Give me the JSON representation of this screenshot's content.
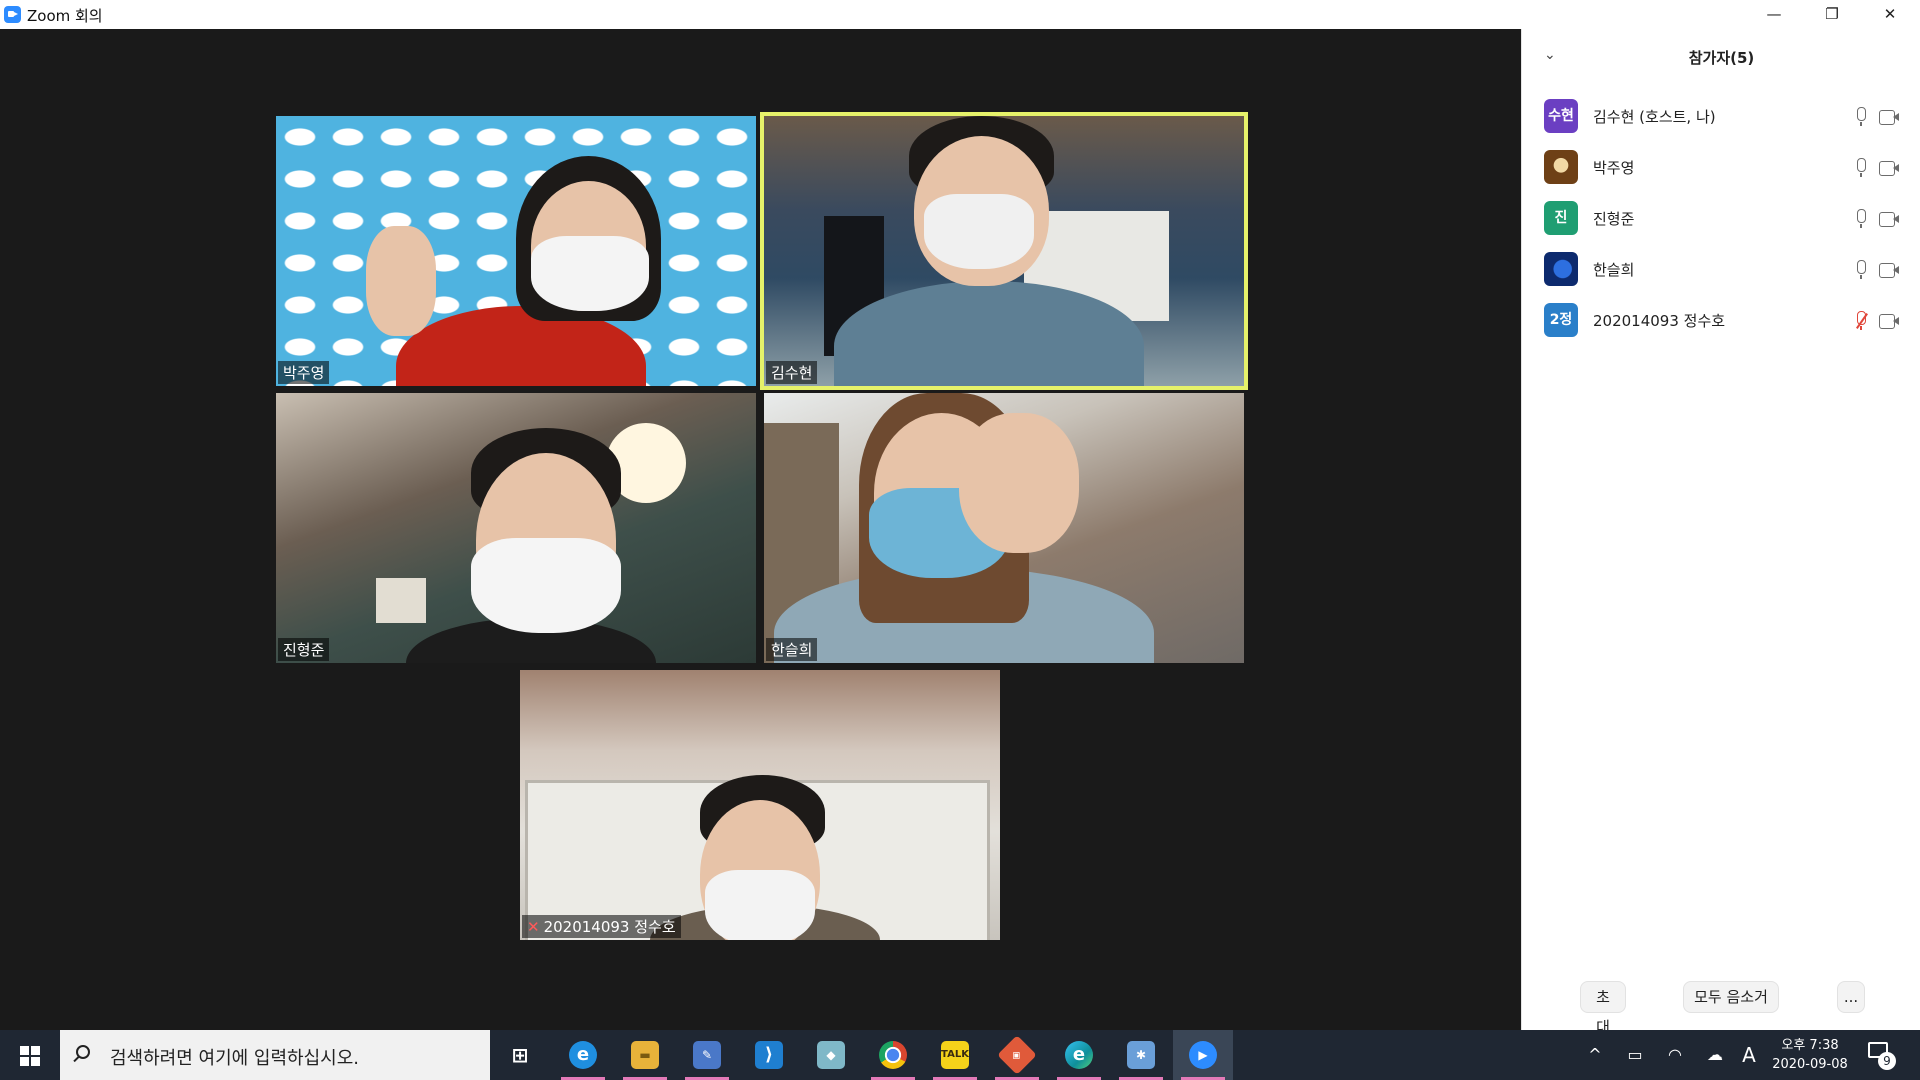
{
  "window": {
    "title": "Zoom 회의",
    "minimize_glyph": "—",
    "restore_glyph": "❐",
    "close_glyph": "✕"
  },
  "stage": {
    "tiles": [
      {
        "name": "박주영",
        "active": false,
        "muted": false
      },
      {
        "name": "김수현",
        "active": true,
        "muted": false
      },
      {
        "name": "진형준",
        "active": false,
        "muted": false
      },
      {
        "name": "한슬희",
        "active": false,
        "muted": false
      },
      {
        "name": "202014093 정수호",
        "active": false,
        "muted": true
      }
    ]
  },
  "panel": {
    "title": "참가자(5)",
    "collapse_glyph": "⌄",
    "participants": [
      {
        "avatar_text": "수현",
        "avatar_color": "#6b3fc2",
        "name": "김수현 (호스트, 나)",
        "muted": false
      },
      {
        "avatar_text": "",
        "avatar_color": "#8a5a1c",
        "name": "박주영",
        "muted": false
      },
      {
        "avatar_text": "진",
        "avatar_color": "#1f9e72",
        "name": "진형준",
        "muted": false
      },
      {
        "avatar_text": "",
        "avatar_color": "#1f4fbf",
        "name": "한슬희",
        "muted": false
      },
      {
        "avatar_text": "2정",
        "avatar_color": "#2a7fc9",
        "name": "202014093 정수호",
        "muted": true
      }
    ],
    "footer": {
      "invite_label": "초대",
      "mute_all_label": "모두 음소거",
      "more_label": "..."
    }
  },
  "taskbar": {
    "search_placeholder": "검색하려면 여기에 입력하십시오.",
    "apps": [
      {
        "icon": "task-view-icon",
        "label": "⊞",
        "color": "#1f2733",
        "running": false
      },
      {
        "icon": "internet-explorer-icon",
        "label": "e",
        "color": "#1f8fe0",
        "running": true
      },
      {
        "icon": "file-explorer-icon",
        "label": "▬",
        "color": "#e8b23a",
        "running": true
      },
      {
        "icon": "notepad-icon",
        "label": "✎",
        "color": "#4a78c8",
        "running": true
      },
      {
        "icon": "vscode-icon",
        "label": "⟩",
        "color": "#1f7fd0",
        "running": false
      },
      {
        "icon": "app-icon",
        "label": "◆",
        "color": "#7fb8c8",
        "running": false
      },
      {
        "icon": "chrome-icon",
        "label": "●",
        "color": "#d9462f",
        "running": true
      },
      {
        "icon": "kakaotalk-icon",
        "label": "TALK",
        "color": "#f5d21a",
        "running": true
      },
      {
        "icon": "git-icon",
        "label": "◈",
        "color": "#e05a3a",
        "running": true
      },
      {
        "icon": "edge-icon",
        "label": "e",
        "color": "#0f8f9a",
        "running": true
      },
      {
        "icon": "paint-icon",
        "label": "✱",
        "color": "#6a9fd8",
        "running": true
      },
      {
        "icon": "zoom-icon",
        "label": "▶",
        "color": "#2d8cff",
        "running": true
      }
    ],
    "tray": {
      "chevron": "^",
      "battery": "▭",
      "network": "◠",
      "cloud": "☁",
      "ime": "A"
    },
    "time": "오후 7:38",
    "date": "2020-09-08",
    "notification_count": "9"
  }
}
